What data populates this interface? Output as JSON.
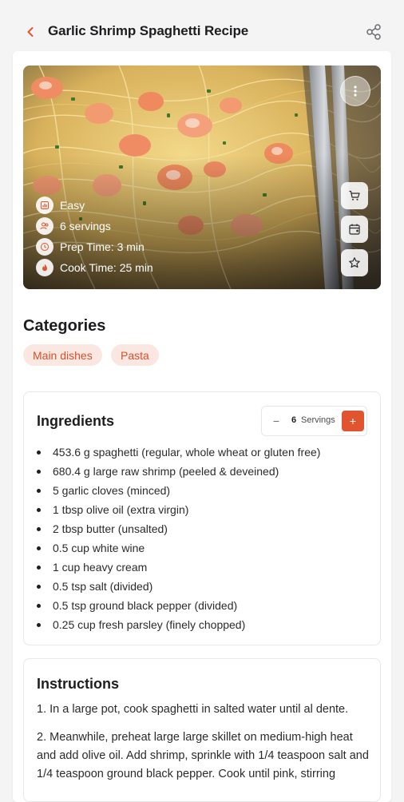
{
  "header": {
    "title": "Garlic Shrimp Spaghetti Recipe",
    "back_icon": "chevron-left-icon",
    "share_icon": "share-icon"
  },
  "hero": {
    "meta": [
      {
        "icon": "bar-chart-icon",
        "text": "Easy"
      },
      {
        "icon": "users-icon",
        "text": "6 servings"
      },
      {
        "icon": "clock-icon",
        "text": "Prep Time: 3 min"
      },
      {
        "icon": "flame-icon",
        "text": "Cook Time: 25 min"
      }
    ],
    "actions": [
      "cart-icon",
      "calendar-add-icon",
      "star-icon"
    ],
    "more_icon": "more-vertical-icon"
  },
  "categories": {
    "title": "Categories",
    "items": [
      "Main dishes",
      "Pasta"
    ]
  },
  "ingredients": {
    "title": "Ingredients",
    "servings_count": "6",
    "servings_label": "Servings",
    "minus": "−",
    "plus": "+",
    "items": [
      "453.6 g spaghetti (regular, whole wheat or gluten free)",
      "680.4 g large raw shrimp (peeled & deveined)",
      "5 garlic cloves (minced)",
      "1 tbsp olive oil (extra virgin)",
      "2 tbsp butter (unsalted)",
      "0.5 cup white wine",
      "1 cup heavy cream",
      "0.5 tsp salt (divided)",
      "0.5 tsp ground black pepper (divided)",
      "0.25 cup fresh parsley (finely chopped)"
    ]
  },
  "instructions": {
    "title": "Instructions",
    "steps": [
      "1. In a large pot, cook spaghetti in salted water until al dente.",
      "2. Meanwhile, preheat large large skillet on medium-high heat and add olive oil. Add shrimp, sprinkle with 1/4 teaspoon salt and 1/4 teaspoon ground black pepper. Cook until pink, stirring"
    ]
  },
  "colors": {
    "accent": "#e0552f",
    "chip_bg": "#fbe7e1",
    "chip_text": "#d4512a"
  }
}
